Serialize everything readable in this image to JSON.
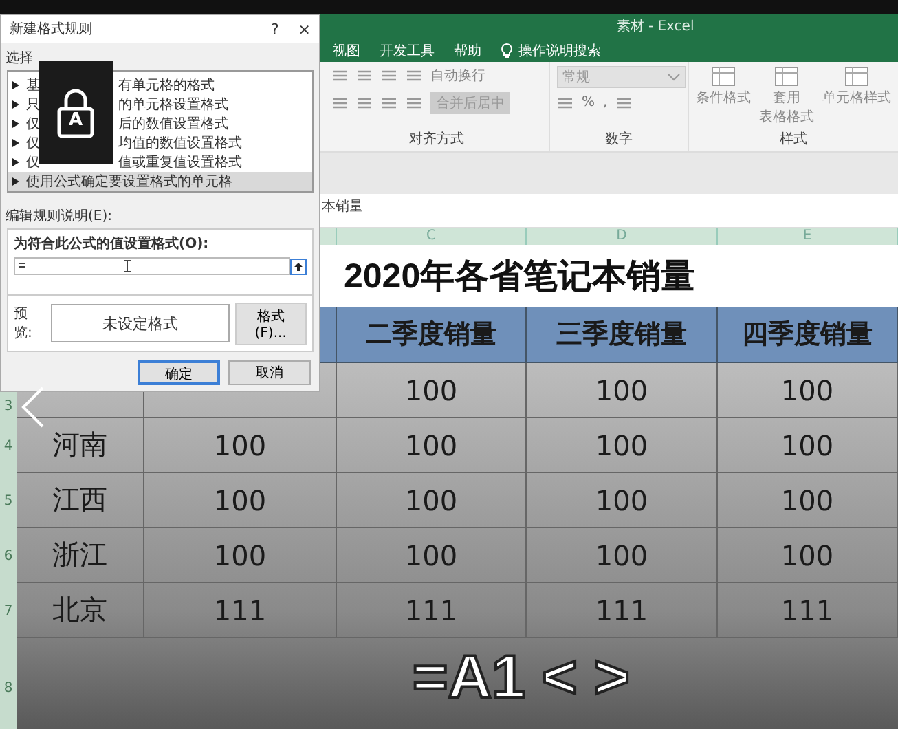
{
  "window": {
    "title": "素材 - Excel"
  },
  "ribbon_tabs": [
    {
      "label": "视图"
    },
    {
      "label": "开发工具"
    },
    {
      "label": "帮助"
    }
  ],
  "tell_me": {
    "placeholder": "操作说明搜索"
  },
  "ribbon": {
    "alignment": {
      "wrap_text": "自动换行",
      "merge": "合并后居中",
      "merge_disabled": true,
      "label": "对齐方式"
    },
    "number": {
      "format": "常规",
      "percent": "%",
      "comma": ",",
      "label": "数字"
    },
    "styles": {
      "items": [
        {
          "lines": [
            "条件格式"
          ]
        },
        {
          "lines": [
            "套用",
            "表格格式"
          ]
        },
        {
          "lines": [
            "单元格样式"
          ]
        }
      ],
      "label": "样式"
    }
  },
  "formula_bar": {
    "value": "本销量"
  },
  "sheet": {
    "columns": [
      "C",
      "D",
      "E"
    ],
    "row_numbers": [
      "3",
      "4",
      "5",
      "6",
      "7",
      "8"
    ],
    "title": "2020年各省笔记本销量",
    "headers": [
      "二季度销量",
      "三季度销量",
      "四季度销量"
    ],
    "rows": [
      {
        "values": [
          "100",
          "100",
          "100"
        ]
      },
      {
        "province": "河南",
        "values": [
          "100",
          "100",
          "100",
          "100"
        ]
      },
      {
        "province": "江西",
        "values": [
          "100",
          "100",
          "100",
          "100"
        ]
      },
      {
        "province": "浙江",
        "values": [
          "100",
          "100",
          "100",
          "100"
        ]
      },
      {
        "province": "北京",
        "values": [
          "111",
          "111",
          "111",
          "111"
        ]
      }
    ]
  },
  "dialog": {
    "title": "新建格式规则",
    "help": "?",
    "close": "×",
    "rule_type_label": "选择",
    "rule_types": [
      {
        "start": "基",
        "end": "有单元格的格式",
        "selected": false
      },
      {
        "start": "只",
        "end": "的单元格设置格式",
        "selected": false
      },
      {
        "start": "仅",
        "end": "后的数值设置格式",
        "selected": false
      },
      {
        "start": "仅",
        "end": "均值的数值设置格式",
        "selected": false
      },
      {
        "start": "仅",
        "end": "值或重复值设置格式",
        "selected": false
      },
      {
        "start": "使用公式确定要设置格式的单元格",
        "selected": true
      }
    ],
    "edit_label": "编辑规则说明(E):",
    "formula_label": "为符合此公式的值设置格式(O):",
    "formula": {
      "value": "="
    },
    "preview_label": "预览:",
    "preview": "未设定格式",
    "format_button": "格式(F)...",
    "buttons": [
      {
        "label": "确定",
        "default": true
      },
      {
        "label": "取消",
        "default": false
      }
    ]
  },
  "lock_overlay": {
    "label": "A"
  },
  "caption": "=A1 < >"
}
